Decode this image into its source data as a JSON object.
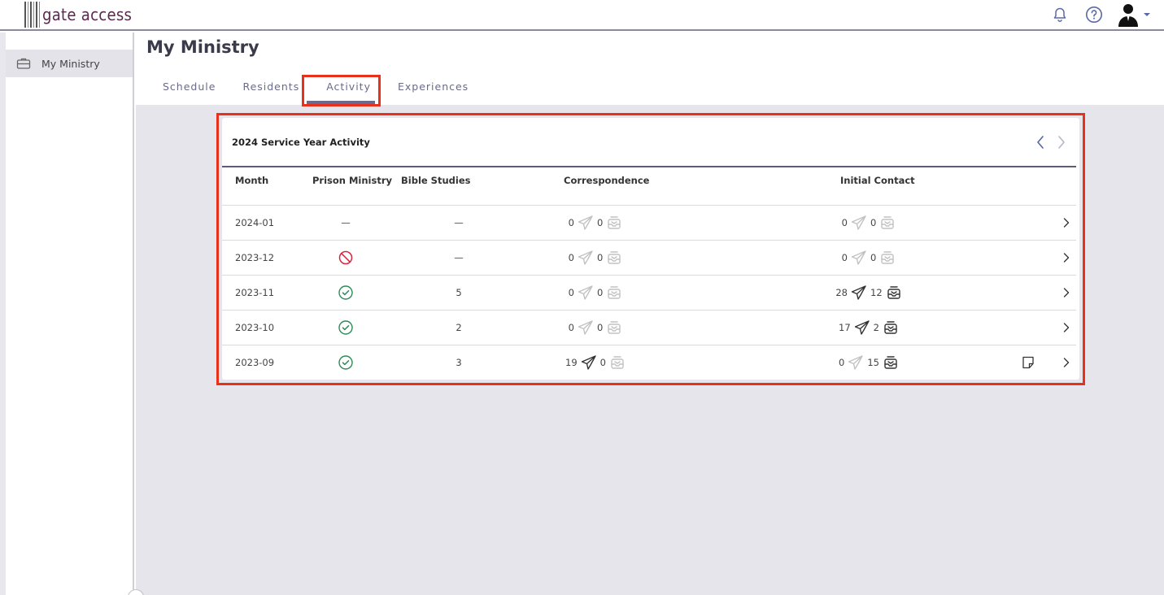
{
  "app": {
    "logo_text": "gate access"
  },
  "sidebar": {
    "items": [
      {
        "label": "My Ministry",
        "icon": "briefcase-icon"
      }
    ]
  },
  "page": {
    "title": "My Ministry"
  },
  "tabs": [
    {
      "label": "Schedule"
    },
    {
      "label": "Residents"
    },
    {
      "label": "Activity",
      "active": true
    },
    {
      "label": "Experiences"
    }
  ],
  "card": {
    "title": "2024 Service Year Activity",
    "columns": [
      "Month",
      "Prison Ministry",
      "Bible Studies",
      "Correspondence",
      "Initial Contact"
    ],
    "rows": [
      {
        "month": "2024-01",
        "prison": "dash",
        "bible": "—",
        "corr_sent": "0",
        "corr_recv": "0",
        "ic_sent": "0",
        "ic_recv": "0",
        "note": false
      },
      {
        "month": "2023-12",
        "prison": "none",
        "bible": "—",
        "corr_sent": "0",
        "corr_recv": "0",
        "ic_sent": "0",
        "ic_recv": "0",
        "note": false
      },
      {
        "month": "2023-11",
        "prison": "check",
        "bible": "5",
        "corr_sent": "0",
        "corr_recv": "0",
        "ic_sent": "28",
        "ic_recv": "12",
        "note": false
      },
      {
        "month": "2023-10",
        "prison": "check",
        "bible": "2",
        "corr_sent": "0",
        "corr_recv": "0",
        "ic_sent": "17",
        "ic_recv": "2",
        "note": false
      },
      {
        "month": "2023-09",
        "prison": "check",
        "bible": "3",
        "corr_sent": "19",
        "corr_recv": "0",
        "ic_sent": "0",
        "ic_recv": "15",
        "note": true
      }
    ]
  },
  "colors": {
    "accent": "#6b5a8e",
    "highlight": "#e8311a",
    "check": "#2e8b57",
    "prohibit": "#d9263d",
    "content_bg": "#e6e5ec"
  }
}
